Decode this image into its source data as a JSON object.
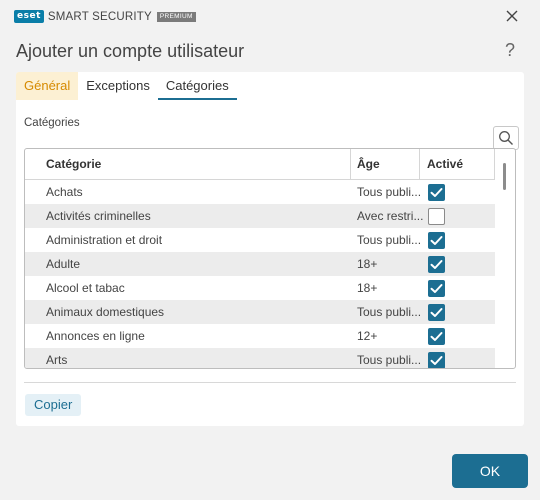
{
  "titlebar": {
    "logo_badge": "eset",
    "product": "SMART SECURITY",
    "edition": "PREMIUM",
    "close_icon": "close-icon"
  },
  "header": {
    "title": "Ajouter un compte utilisateur",
    "help_label": "?"
  },
  "tabs": [
    {
      "label": "Général"
    },
    {
      "label": "Exceptions"
    },
    {
      "label": "Catégories"
    }
  ],
  "active_tab": "Catégories",
  "section": {
    "label": "Catégories",
    "search_icon": "search-icon"
  },
  "table": {
    "columns": [
      "Catégorie",
      "Âge",
      "Activé"
    ],
    "rows": [
      {
        "name": "Achats",
        "age": "Tous publi...",
        "enabled": true
      },
      {
        "name": "Activités criminelles",
        "age": "Avec restri...",
        "enabled": false
      },
      {
        "name": "Administration et droit",
        "age": "Tous publi...",
        "enabled": true
      },
      {
        "name": "Adulte",
        "age": "18+",
        "enabled": true
      },
      {
        "name": "Alcool et tabac",
        "age": "18+",
        "enabled": true
      },
      {
        "name": "Animaux domestiques",
        "age": "Tous publi...",
        "enabled": true
      },
      {
        "name": "Annonces en ligne",
        "age": "12+",
        "enabled": true
      },
      {
        "name": "Arts",
        "age": "Tous publi...",
        "enabled": true
      }
    ]
  },
  "footer": {
    "copy_label": "Copier",
    "ok_label": "OK"
  },
  "colors": {
    "accent": "#1c6e92",
    "general_tab_bg": "#fcf0d3",
    "general_tab_text": "#d68a00"
  }
}
